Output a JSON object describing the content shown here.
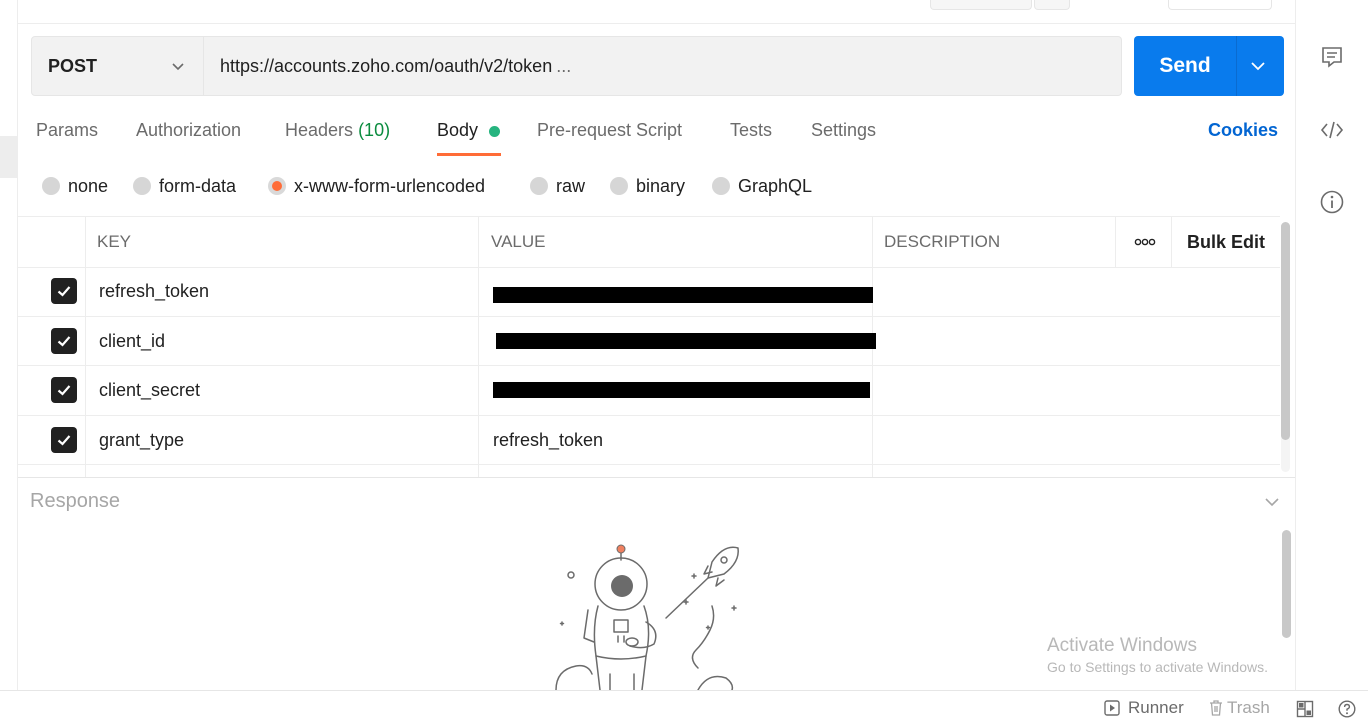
{
  "request": {
    "method": "POST",
    "url": "https://accounts.zoho.com/oauth/v2/token",
    "url_ellipsis": "...",
    "send_label": "Send"
  },
  "tabs": [
    {
      "label": "Params"
    },
    {
      "label": "Authorization"
    },
    {
      "label": "Headers",
      "count": "(10)"
    },
    {
      "label": "Body"
    },
    {
      "label": "Pre-request Script"
    },
    {
      "label": "Tests"
    },
    {
      "label": "Settings"
    }
  ],
  "cookies_label": "Cookies",
  "body_types": [
    {
      "label": "none",
      "selected": false
    },
    {
      "label": "form-data",
      "selected": false
    },
    {
      "label": "x-www-form-urlencoded",
      "selected": true
    },
    {
      "label": "raw",
      "selected": false
    },
    {
      "label": "binary",
      "selected": false
    },
    {
      "label": "GraphQL",
      "selected": false
    }
  ],
  "table": {
    "headers": {
      "key": "KEY",
      "value": "VALUE",
      "description": "DESCRIPTION",
      "bulk_edit": "Bulk Edit"
    },
    "rows": [
      {
        "checked": true,
        "key": "refresh_token",
        "value": "",
        "redacted": true
      },
      {
        "checked": true,
        "key": "client_id",
        "value": "",
        "redacted": true
      },
      {
        "checked": true,
        "key": "client_secret",
        "value": "",
        "redacted": true
      },
      {
        "checked": true,
        "key": "grant_type",
        "value": "refresh_token",
        "redacted": false
      }
    ]
  },
  "response": {
    "title": "Response"
  },
  "watermark": {
    "line1": "Activate Windows",
    "line2": "Go to Settings to activate Windows."
  },
  "status_bar": {
    "runner": "Runner",
    "trash": "Trash"
  },
  "colors": {
    "accent": "#ff6c37",
    "send_blue": "#097bed",
    "cookies_blue": "#0265d2",
    "count_green": "#0b8c3f",
    "body_dot": "#26b47f"
  },
  "icons": [
    "chevron-down-icon",
    "comment-icon",
    "code-icon",
    "info-icon",
    "more-icon",
    "runner-icon",
    "trash-icon",
    "two-pane-icon",
    "help-icon",
    "astronaut-illustration"
  ]
}
